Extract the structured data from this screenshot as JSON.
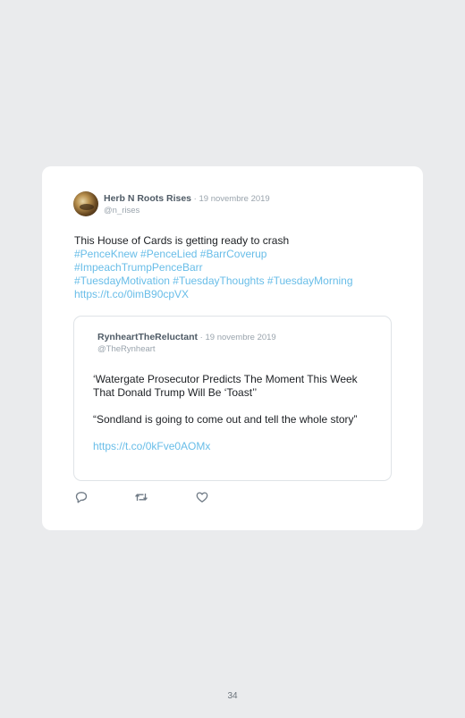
{
  "tweet": {
    "author_name": "Herb N Roots Rises",
    "separator": " · ",
    "date": "19 novembre 2019",
    "handle": "@n_rises",
    "text_lines": [
      {
        "text": "This House of Cards is getting ready to crash",
        "is_link": false
      },
      {
        "text": "#PenceKnew #PenceLied #BarrCoverup",
        "is_link": true
      },
      {
        "text": "#ImpeachTrumpPenceBarr",
        "is_link": true
      },
      {
        "text": "#TuesdayMotivation #TuesdayThoughts #TuesdayMorning",
        "is_link": true
      },
      {
        "text": "https://t.co/0imB90cpVX",
        "is_link": true
      }
    ]
  },
  "quoted_tweet": {
    "author_name": "RynheartTheReluctant",
    "separator": " · ",
    "date": "19 novembre 2019",
    "handle": "@TheRynheart",
    "paragraph_1": "‘Watergate Prosecutor Predicts The Moment This Week That Donald Trump Will Be ‘Toast’’",
    "paragraph_2": "“Sondland is going to come out and tell the whole story”",
    "link": "https://t.co/0kFve0AOMx"
  },
  "actions": {
    "icons": [
      "reply-icon",
      "retweet-icon",
      "like-icon"
    ]
  },
  "colors": {
    "link": "#68bde8",
    "background": "#eaebed",
    "card": "#ffffff"
  },
  "page_number": "34"
}
